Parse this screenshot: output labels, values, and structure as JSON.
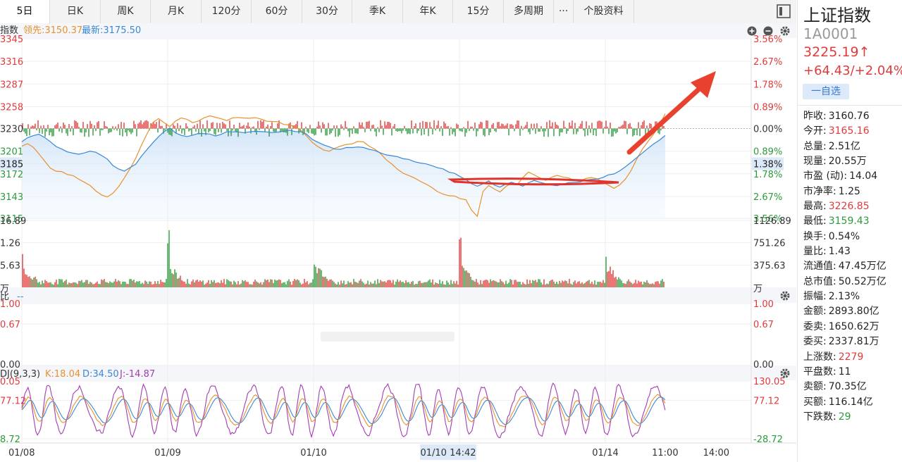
{
  "tabs": [
    "5日",
    "日K",
    "周K",
    "月K",
    "120分",
    "60分",
    "30分",
    "季K",
    "年K",
    "15分",
    "多周期",
    "···",
    "个股资料"
  ],
  "stock": {
    "name": "上证指数",
    "code": "1A0001",
    "price": "3225.19↑",
    "change": "+64.43/+2.04%",
    "watch_label": "一自选"
  },
  "stats": [
    {
      "label": "昨收:",
      "value": "3160.76",
      "color": "#222222"
    },
    {
      "label": "今开:",
      "value": "3165.16",
      "color": "#e03b3b"
    },
    {
      "label": "总量:",
      "value": "2.51亿",
      "color": "#222222"
    },
    {
      "label": "现量:",
      "value": "20.55万",
      "color": "#222222"
    },
    {
      "label": "市盈 (动):",
      "value": "14.04",
      "color": "#222222"
    },
    {
      "label": "市净率:",
      "value": "1.25",
      "color": "#222222"
    },
    {
      "label": "最高:",
      "value": "3226.85",
      "color": "#e03b3b"
    },
    {
      "label": "最低:",
      "value": "3159.43",
      "color": "#2c9b3c"
    },
    {
      "label": "换手:",
      "value": "0.54%",
      "color": "#222222"
    },
    {
      "label": "量比:",
      "value": "1.43",
      "color": "#222222"
    },
    {
      "label": "流通值:",
      "value": "47.45万亿",
      "color": "#222222"
    },
    {
      "label": "总市值:",
      "value": "50.52万亿",
      "color": "#222222"
    },
    {
      "label": "振幅:",
      "value": "2.13%",
      "color": "#222222"
    },
    {
      "label": "金额:",
      "value": "2893.80亿",
      "color": "#222222"
    },
    {
      "label": "委卖:",
      "value": "1650.62万",
      "color": "#222222"
    },
    {
      "label": "委买:",
      "value": "2337.81万",
      "color": "#222222"
    },
    {
      "label": "上涨数:",
      "value": "2279",
      "color": "#e03b3b"
    },
    {
      "label": "平盘数:",
      "value": "11",
      "color": "#222222"
    },
    {
      "label": "卖额:",
      "value": "70.35亿",
      "color": "#222222"
    },
    {
      "label": "买额:",
      "value": "116.14亿",
      "color": "#222222"
    },
    {
      "label": "下跌数:",
      "value": "29",
      "color": "#2c9b3c"
    }
  ],
  "chart_data": [
    {
      "type": "line",
      "header": {
        "name": "指数",
        "leading": "领先:3150.37",
        "latest": "最新:3175.50"
      },
      "y_ticks_left": [
        "3345",
        "3316",
        "3287",
        "3258",
        "3230",
        "3201",
        "3185",
        "3172",
        "3143",
        "3115"
      ],
      "y_ticks_right": [
        "3.56%",
        "2.67%",
        "1.78%",
        "0.89%",
        "0.00%",
        "0.89%",
        "1.38%",
        "1.78%",
        "2.67%",
        "3.56%"
      ],
      "ylim": [
        3115,
        3345
      ],
      "baseline": 3230,
      "x_labels": [
        "01/08",
        "01/09",
        "01/10",
        "01/10 14:42",
        "01/14",
        "11:00",
        "14:00"
      ],
      "days": 5,
      "current_day_fraction": 0.41,
      "series": [
        {
          "name": "最新",
          "color": "#3a88d6",
          "values": [
            3213,
            3218,
            3221,
            3222,
            3219,
            3214,
            3207,
            3203,
            3200,
            3199,
            3198,
            3199,
            3201,
            3200,
            3196,
            3190,
            3183,
            3178,
            3176,
            3180,
            3185,
            3194,
            3203,
            3212,
            3220,
            3227,
            3230,
            3225,
            3221,
            3220,
            3222,
            3223,
            3224,
            3222,
            3221,
            3223,
            3225,
            3226,
            3225,
            3224,
            3225,
            3226,
            3227,
            3226,
            3225,
            3226,
            3227,
            3228,
            3227,
            3226,
            3223,
            3217,
            3213,
            3210,
            3206,
            3204,
            3203,
            3205,
            3206,
            3207,
            3205,
            3203,
            3201,
            3199,
            3197,
            3195,
            3193,
            3192,
            3190,
            3188,
            3186,
            3184,
            3182,
            3180,
            3178,
            3175,
            3172,
            3168,
            3164,
            3160,
            3156,
            3159,
            3162,
            3157,
            3154,
            3158,
            3162,
            3159,
            3156,
            3160,
            3163,
            3161,
            3159,
            3158,
            3157,
            3159,
            3160,
            3161,
            3162,
            3163,
            3164,
            3166,
            3168,
            3170,
            3172,
            3175,
            3180,
            3186,
            3192,
            3198,
            3204,
            3210,
            3216,
            3222
          ]
        },
        {
          "name": "领先",
          "color": "#e8912e",
          "values": [
            3207,
            3210,
            3205,
            3198,
            3188,
            3180,
            3176,
            3175,
            3172,
            3169,
            3165,
            3162,
            3158,
            3150,
            3144,
            3143,
            3148,
            3156,
            3166,
            3178,
            3192,
            3208,
            3224,
            3238,
            3243,
            3237,
            3233,
            3240,
            3244,
            3241,
            3238,
            3240,
            3243,
            3246,
            3245,
            3242,
            3241,
            3243,
            3245,
            3244,
            3243,
            3244,
            3242,
            3240,
            3239,
            3238,
            3236,
            3234,
            3232,
            3227,
            3220,
            3213,
            3207,
            3203,
            3201,
            3204,
            3207,
            3209,
            3211,
            3213,
            3212,
            3207,
            3203,
            3198,
            3191,
            3184,
            3177,
            3172,
            3169,
            3166,
            3162,
            3158,
            3154,
            3150,
            3146,
            3144,
            3143,
            3141,
            3139,
            3126,
            3118,
            3150,
            3158,
            3152,
            3149,
            3155,
            3161,
            3158,
            3168,
            3174,
            3171,
            3167,
            3164,
            3168,
            3170,
            3168,
            3166,
            3163,
            3162,
            3165,
            3168,
            3165,
            3161,
            3157,
            3154,
            3158,
            3165,
            3176,
            3190,
            3203,
            3214,
            3224,
            3234,
            3248
          ]
        }
      ]
    },
    {
      "type": "bar",
      "label": "万",
      "y_ticks_left": [
        "16.89",
        "1.26",
        "5.63",
        "万"
      ],
      "y_ticks_right": [
        "1126.89",
        "751.26",
        "375.63",
        "万"
      ],
      "ylim": [
        0,
        1126.89
      ],
      "spike_day_indices": [
        0,
        1,
        2,
        3,
        4
      ],
      "typical_level": 110,
      "open_spike_values": [
        580,
        1126.89,
        420,
        1126.89,
        520
      ]
    },
    {
      "type": "line",
      "header": {
        "name": "量比",
        "value": "--"
      },
      "y_ticks_left": [
        "1.00",
        "0.67",
        "0.00"
      ],
      "y_ticks_right": [
        "1.00",
        "0.67",
        "0.00"
      ],
      "ylim": [
        0,
        1
      ]
    },
    {
      "type": "line",
      "header": {
        "name": "KDJ(9,3,3)",
        "k": "K:18.04",
        "d": "D:34.50",
        "j": "J:-14.87"
      },
      "y_ticks_left": [
        "0.05",
        "77.12",
        "8.72"
      ],
      "y_ticks_right": [
        "130.05",
        "77.12",
        "-28.72"
      ],
      "ylim": [
        -28.72,
        130.05
      ],
      "series": [
        {
          "name": "K",
          "color": "#e8912e",
          "last": 18.04
        },
        {
          "name": "D",
          "color": "#3a88d6",
          "last": 34.5
        },
        {
          "name": "J",
          "color": "#a43bb4",
          "last": -14.87
        }
      ]
    }
  ],
  "colors": {
    "up": "#e03b3b",
    "down": "#2c9b3c",
    "grid": "#eeeeee"
  },
  "icons": [
    "layout-toggle-icon",
    "zoom-in-icon",
    "zoom-out-icon",
    "gear-icon",
    "annotation-arrow"
  ]
}
